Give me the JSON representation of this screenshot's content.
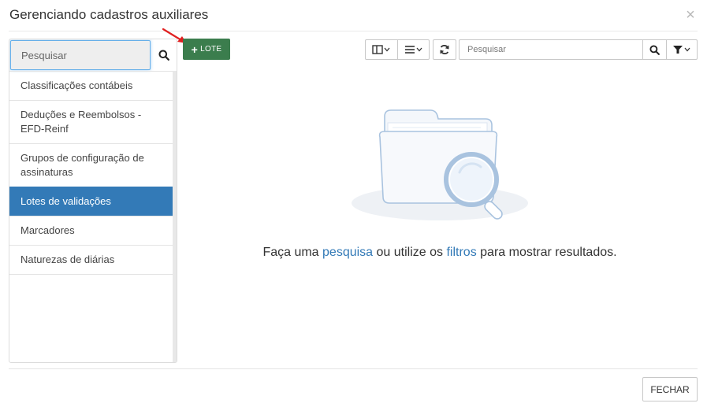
{
  "modal": {
    "title": "Gerenciando cadastros auxiliares",
    "close_icon": "close-icon"
  },
  "sidebar": {
    "search_placeholder": "Pesquisar",
    "items": [
      {
        "label": "Classificações contábeis",
        "active": false
      },
      {
        "label": "Deduções e Reembolsos - EFD-Reinf",
        "active": false
      },
      {
        "label": "Grupos de configuração de assinaturas",
        "active": false
      },
      {
        "label": "Lotes de validações",
        "active": true
      },
      {
        "label": "Marcadores",
        "active": false
      },
      {
        "label": "Naturezas de diárias",
        "active": false
      }
    ]
  },
  "toolbar": {
    "add_label": "LOTE",
    "add_icon": "plus-icon",
    "search_placeholder": "Pesquisar",
    "icons": [
      "columns-icon",
      "list-icon",
      "refresh-icon",
      "search-icon",
      "filter-icon"
    ]
  },
  "empty_state": {
    "prefix": "Faça uma ",
    "link_search": "pesquisa",
    "middle": " ou utilize os ",
    "link_filters": "filtros",
    "suffix": " para mostrar resultados."
  },
  "footer": {
    "close_label": "FECHAR"
  },
  "colors": {
    "active_item": "#337ab7",
    "add_button": "#3b7d4d",
    "link": "#337ab7",
    "annotation_arrow": "#e02020"
  }
}
